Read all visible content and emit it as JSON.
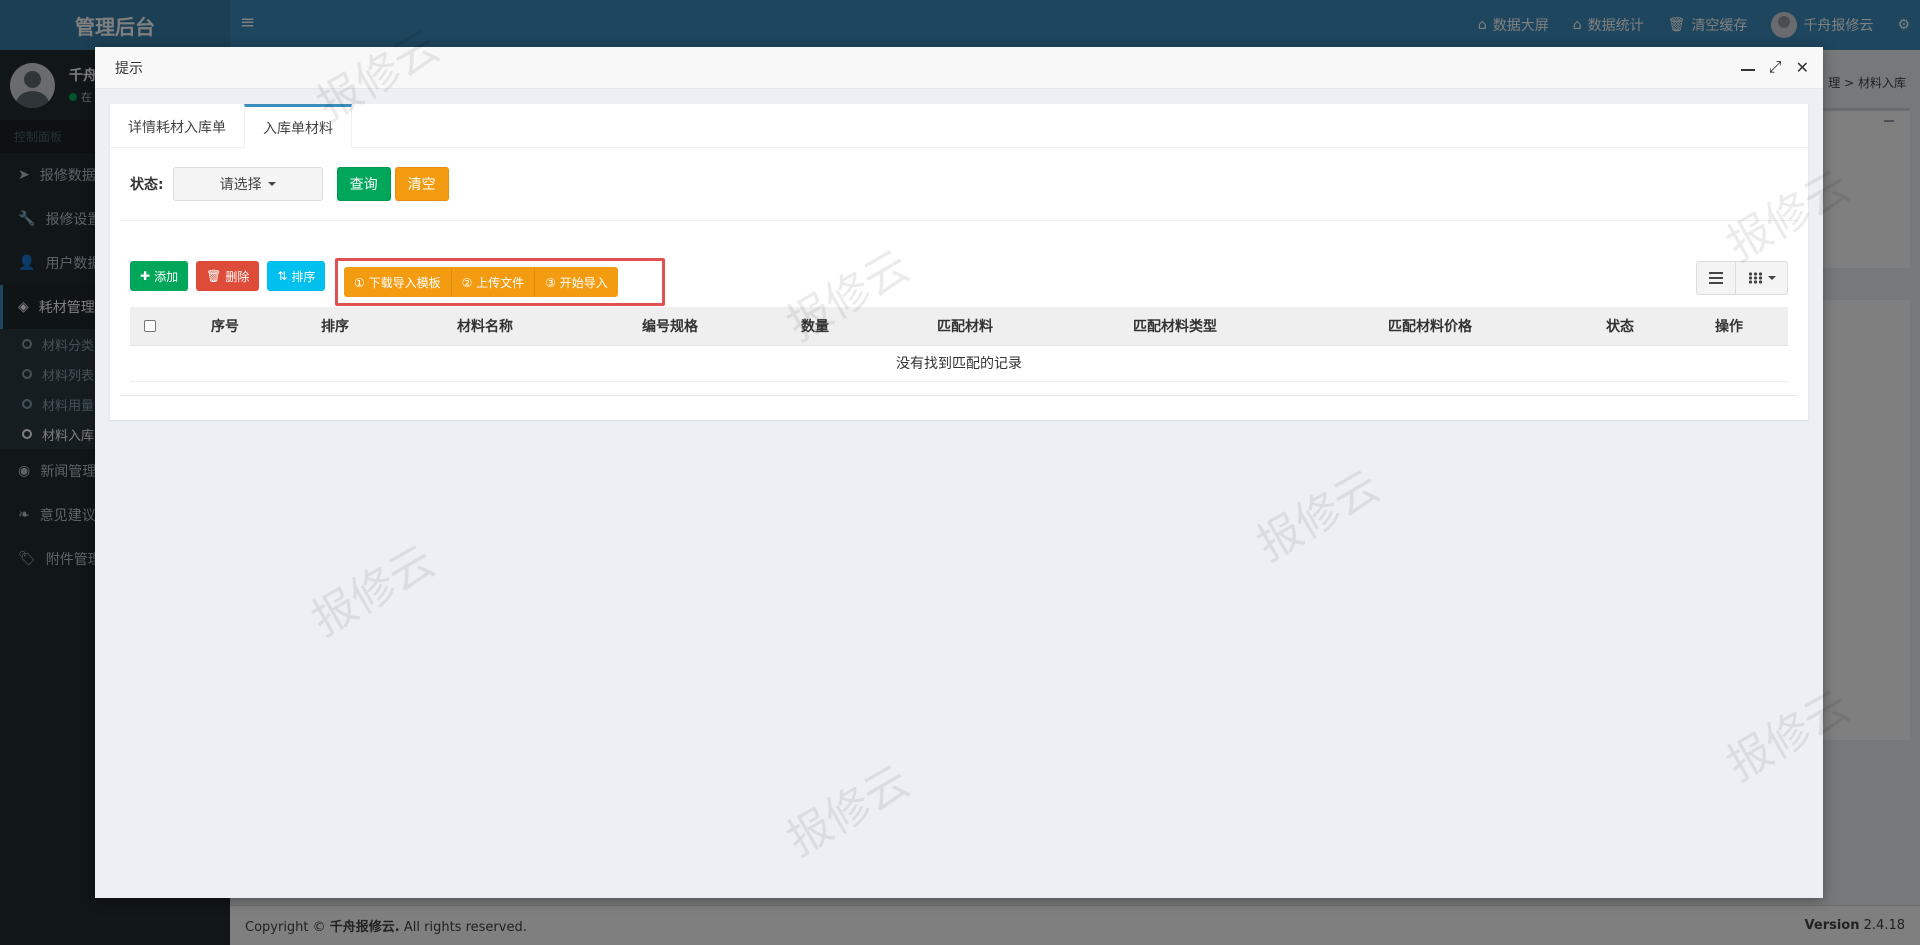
{
  "app": {
    "brand": "管理后台",
    "top_nav": [
      {
        "icon": "home-icon",
        "label": "数据大屏"
      },
      {
        "icon": "home-icon",
        "label": "数据统计"
      },
      {
        "icon": "trash-icon",
        "label": "清空缓存"
      },
      {
        "icon": "avatar",
        "label": "千舟报修云"
      }
    ]
  },
  "sidebar": {
    "user_name": "千舟",
    "user_status": "在",
    "header": "控制面板",
    "items": [
      {
        "label": "报修数据",
        "icon": "send-icon"
      },
      {
        "label": "报修设置",
        "icon": "wrench-icon"
      },
      {
        "label": "用户数据",
        "icon": "user-icon"
      },
      {
        "label": "耗材管理",
        "icon": "cube-icon"
      }
    ],
    "sub_items": [
      "材料分类",
      "材料列表",
      "材料用量",
      "材料入库"
    ],
    "items_after": [
      {
        "label": "新闻管理",
        "icon": "rss-icon"
      },
      {
        "label": "意见建议",
        "icon": "leaf-icon"
      },
      {
        "label": "附件管理",
        "icon": "tags-icon"
      }
    ]
  },
  "breadcrumb": {
    "part1": "理",
    "sep": ">",
    "part2": "材料入库"
  },
  "footer": {
    "copyright_prefix": "Copyright © ",
    "copyright_company": "千舟报修云.",
    "copyright_suffix": " All rights reserved.",
    "version_label": "Version",
    "version_value": "2.4.18"
  },
  "modal": {
    "title": "提示",
    "tabs": [
      "详情耗材入库单",
      "入库单材料"
    ],
    "active_tab": 1,
    "filter": {
      "label": "状态:",
      "select_value": "请选择",
      "query_button": "查询",
      "clear_button": "清空"
    },
    "toolbar": {
      "add": "添加",
      "delete": "删除",
      "sort": "排序",
      "import_template": "① 下载导入模板",
      "upload_file": "② 上传文件",
      "start_import": "③ 开始导入"
    },
    "table": {
      "columns": [
        "序号",
        "排序",
        "材料名称",
        "编号规格",
        "数量",
        "匹配材料",
        "匹配材料类型",
        "匹配材料价格",
        "状态",
        "操作"
      ],
      "empty_text": "没有找到匹配的记录"
    }
  },
  "watermark": "报修云",
  "colors": {
    "primary": "#3c8dbc",
    "success": "#00a65a",
    "warning": "#f39c12",
    "danger": "#dd4b39",
    "info": "#00c0ef",
    "highlight": "#e05252"
  }
}
